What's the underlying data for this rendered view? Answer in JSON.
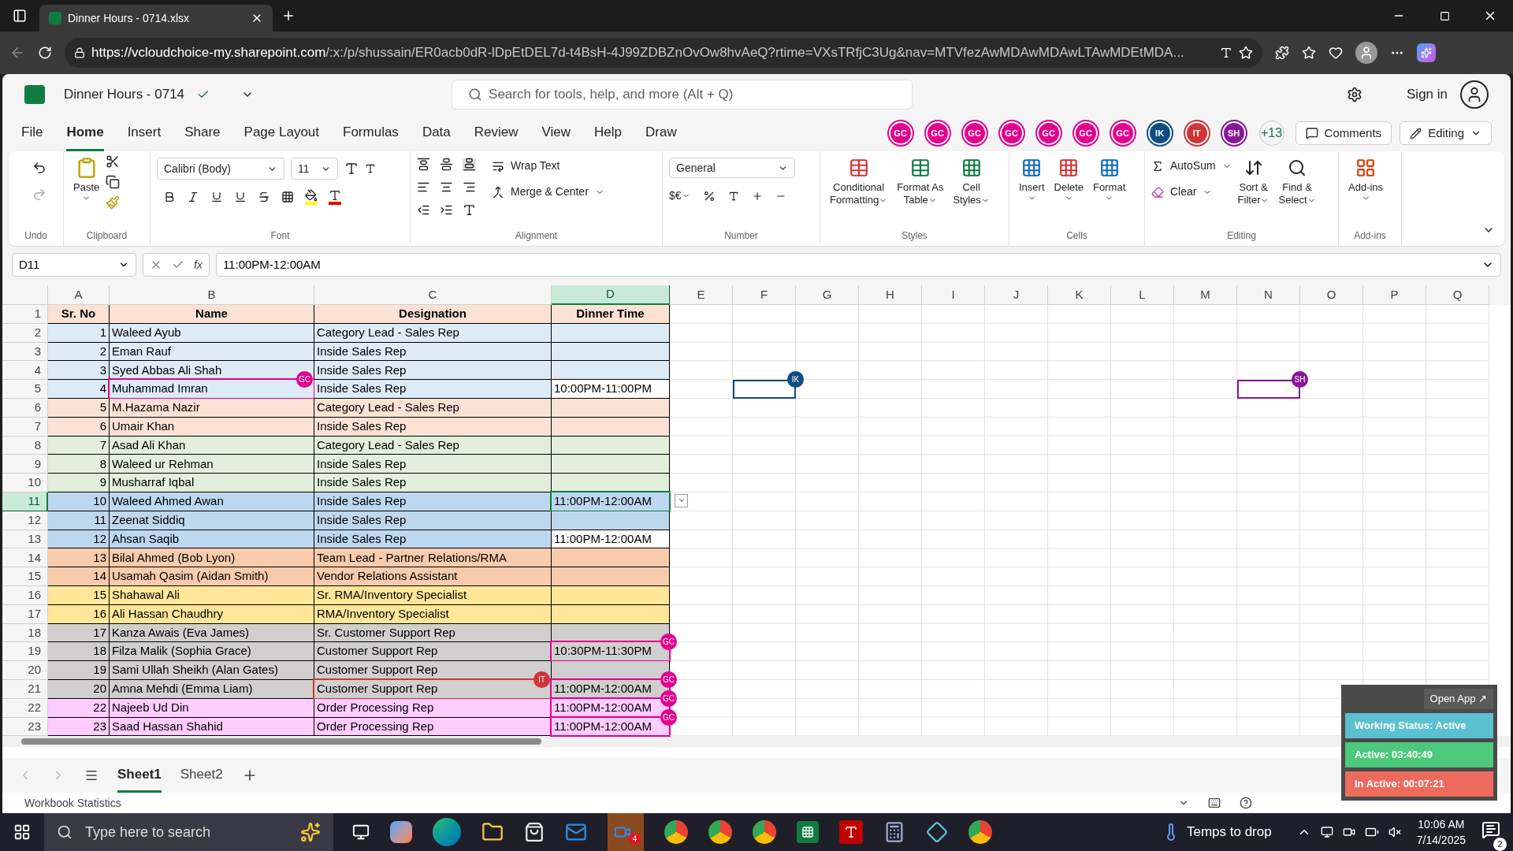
{
  "browser": {
    "tab_title": "Dinner Hours - 0714.xlsx",
    "url_host": "https://vcloudchoice-my.sharepoint.com",
    "url_rest": "/:x:/p/shussain/ER0acb0dR-lDpEtDEL7d-t4BsH-4J99ZDBZnOvOw8hvAeQ?rtime=VXsTRfjC3Ug&nav=MTVfezAwMDAwMDAwLTAwMDEtMDA..."
  },
  "app": {
    "file_name": "Dinner Hours - 0714",
    "search_placeholder": "Search for tools, help, and more (Alt + Q)",
    "sign_in": "Sign in"
  },
  "menu": [
    {
      "label": "File",
      "selected": false
    },
    {
      "label": "Home",
      "selected": true
    },
    {
      "label": "Insert",
      "selected": false
    },
    {
      "label": "Share",
      "selected": false
    },
    {
      "label": "Page Layout",
      "selected": false
    },
    {
      "label": "Formulas",
      "selected": false
    },
    {
      "label": "Data",
      "selected": false
    },
    {
      "label": "Review",
      "selected": false
    },
    {
      "label": "View",
      "selected": false
    },
    {
      "label": "Help",
      "selected": false
    },
    {
      "label": "Draw",
      "selected": false
    }
  ],
  "collaborators": [
    {
      "initials": "GC",
      "color": "#e3008c"
    },
    {
      "initials": "GC",
      "color": "#e3008c"
    },
    {
      "initials": "GC",
      "color": "#e3008c"
    },
    {
      "initials": "GC",
      "color": "#e3008c"
    },
    {
      "initials": "GC",
      "color": "#e3008c"
    },
    {
      "initials": "GC",
      "color": "#e3008c"
    },
    {
      "initials": "GC",
      "color": "#e3008c"
    },
    {
      "initials": "IK",
      "color": "#0f4c81"
    },
    {
      "initials": "IT",
      "color": "#d13438"
    },
    {
      "initials": "SH",
      "color": "#881798"
    }
  ],
  "more_collaborators": "+13",
  "comments": "Comments",
  "editing": "Editing",
  "ribbon": {
    "undo_group": "Undo",
    "paste": "Paste",
    "clipboard_group": "Clipboard",
    "font_name": "Calibri (Body)",
    "font_size": "11",
    "font_group": "Font",
    "wrap_text": "Wrap Text",
    "merge_center": "Merge & Center",
    "alignment_group": "Alignment",
    "number_format": "General",
    "currency": "$€",
    "number_group": "Number",
    "conditional_1": "Conditional",
    "conditional_2": "Formatting",
    "format_table_1": "Format As",
    "format_table_2": "Table",
    "cell_styles_1": "Cell",
    "cell_styles_2": "Styles",
    "styles_group": "Styles",
    "insert": "Insert",
    "delete": "Delete",
    "format": "Format",
    "cells_group": "Cells",
    "autosum": "AutoSum",
    "clear": "Clear",
    "sort_1": "Sort &",
    "sort_2": "Filter",
    "find_1": "Find &",
    "find_2": "Select",
    "editing_group": "Editing",
    "addins": "Add-ins",
    "addins_group": "Add-ins"
  },
  "formula_bar": {
    "name_box": "D11",
    "fx": "fx",
    "value": "11:00PM-12:00AM"
  },
  "sheet": {
    "columns": [
      {
        "label": "A",
        "selected": false
      },
      {
        "label": "B",
        "selected": false
      },
      {
        "label": "C",
        "selected": false
      },
      {
        "label": "D",
        "selected": true
      },
      {
        "label": "E",
        "selected": false
      },
      {
        "label": "F",
        "selected": false
      },
      {
        "label": "G",
        "selected": false
      },
      {
        "label": "H",
        "selected": false
      },
      {
        "label": "I",
        "selected": false
      },
      {
        "label": "J",
        "selected": false
      },
      {
        "label": "K",
        "selected": false
      },
      {
        "label": "L",
        "selected": false
      },
      {
        "label": "M",
        "selected": false
      },
      {
        "label": "N",
        "selected": false
      },
      {
        "label": "O",
        "selected": false
      },
      {
        "label": "P",
        "selected": false
      },
      {
        "label": "Q",
        "selected": false
      }
    ],
    "header_row": {
      "number": "1",
      "no": "Sr. No",
      "name": "Name",
      "designation": "Designation",
      "dinner_time": "Dinner Time",
      "color": "#fbe2d5"
    },
    "rows": [
      {
        "number": "2",
        "no": "1",
        "name": "Waleed Ayub",
        "designation": "Category Lead - Sales Rep",
        "color": "#ddebf7",
        "selected": false
      },
      {
        "number": "3",
        "no": "2",
        "name": "Eman Rauf",
        "designation": "Inside Sales Rep",
        "color": "#ddebf7",
        "selected": false
      },
      {
        "number": "4",
        "no": "3",
        "name": "Syed Abbas Ali Shah",
        "designation": "Inside Sales Rep",
        "color": "#ddebf7",
        "selected": false
      },
      {
        "number": "5",
        "no": "4",
        "name": "Muhammad Imran",
        "designation": "Inside Sales Rep",
        "dinner_time": "10:00PM-11:00PM",
        "color": "#ddebf7",
        "selected": false,
        "presence": {
          "B": {
            "initials": "GC",
            "color": "#e3008c"
          },
          "F": {
            "initials": "IK",
            "color": "#0f4c81"
          },
          "N": {
            "initials": "SH",
            "color": "#881798"
          }
        }
      },
      {
        "number": "6",
        "no": "5",
        "name": "M.Hazama Nazir",
        "designation": "Category Lead - Sales Rep",
        "color": "#fbe2d5",
        "selected": false
      },
      {
        "number": "7",
        "no": "6",
        "name": "Umair Khan",
        "designation": "Inside Sales Rep",
        "color": "#fbe2d5",
        "selected": false
      },
      {
        "number": "8",
        "no": "7",
        "name": "Asad Ali Khan",
        "designation": "Category Lead - Sales Rep",
        "color": "#e2efda",
        "selected": false
      },
      {
        "number": "9",
        "no": "8",
        "name": "Waleed ur Rehman",
        "designation": "Inside Sales Rep",
        "color": "#e2efda",
        "selected": false
      },
      {
        "number": "10",
        "no": "9",
        "name": "Musharraf Iqbal",
        "designation": "Inside Sales Rep",
        "color": "#e2efda",
        "selected": false
      },
      {
        "number": "11",
        "no": "10",
        "name": "Waleed Ahmed Awan",
        "designation": "Inside Sales Rep",
        "dinner_time": "11:00PM-12:00AM",
        "color": "#bdd7ee",
        "selected": true
      },
      {
        "number": "12",
        "no": "11",
        "name": "Zeenat Siddiq",
        "designation": "Inside Sales Rep",
        "color": "#bdd7ee",
        "selected": false
      },
      {
        "number": "13",
        "no": "12",
        "name": "Ahsan Saqib",
        "designation": "Inside Sales Rep",
        "dinner_time": "11:00PM-12:00AM",
        "color": "#bdd7ee",
        "selected": false
      },
      {
        "number": "14",
        "no": "13",
        "name": "Bilal Ahmed (Bob Lyon)",
        "designation": "Team Lead - Partner Relations/RMA",
        "color": "#f8cbad",
        "selected": false
      },
      {
        "number": "15",
        "no": "14",
        "name": "Usamah Qasim (Aidan Smith)",
        "designation": "Vendor Relations Assistant",
        "color": "#f8cbad",
        "selected": false
      },
      {
        "number": "16",
        "no": "15",
        "name": "Shahawal Ali",
        "designation": "Sr. RMA/Inventory Specialist",
        "color": "#ffe699",
        "selected": false
      },
      {
        "number": "17",
        "no": "16",
        "name": "Ali Hassan Chaudhry",
        "designation": "RMA/Inventory Specialist",
        "color": "#ffe699",
        "selected": false
      },
      {
        "number": "18",
        "no": "17",
        "name": "Kanza Awais (Eva James)",
        "designation": "Sr. Customer Support Rep",
        "color": "#d0cece",
        "selected": false
      },
      {
        "number": "19",
        "no": "18",
        "name": "Filza Malik (Sophia Grace)",
        "designation": "Customer Support Rep",
        "dinner_time": "10:30PM-11:30PM",
        "color": "#d0cece",
        "selected": false,
        "presence": {
          "D": {
            "initials": "GC",
            "color": "#e3008c"
          }
        }
      },
      {
        "number": "20",
        "no": "19",
        "name": "Sami Ullah Sheikh (Alan Gates)",
        "designation": "Customer Support Rep",
        "color": "#d0cece",
        "selected": false
      },
      {
        "number": "21",
        "no": "20",
        "name": "Amna Mehdi (Emma Liam)",
        "designation": "Customer Support Rep",
        "dinner_time": "11:00PM-12:00AM",
        "color": "#d0cece",
        "selected": false,
        "presence": {
          "C": {
            "initials": "IT",
            "color": "#d13438"
          },
          "D": {
            "initials": "GC",
            "color": "#e3008c"
          }
        }
      },
      {
        "number": "22",
        "no": "22",
        "name": "Najeeb Ud Din",
        "designation": "Order Processing Rep",
        "dinner_time": "11:00PM-12:00AM",
        "color": "#ffccff",
        "selected": false,
        "presence": {
          "D": {
            "initials": "GC",
            "color": "#e3008c"
          }
        }
      },
      {
        "number": "23",
        "no": "23",
        "name": "Saad Hassan Shahid",
        "designation": "Order Processing Rep",
        "dinner_time": "11:00PM-12:00AM",
        "color": "#ffccff",
        "selected": false,
        "presence": {
          "D": {
            "initials": "GC",
            "color": "#e3008c"
          }
        }
      }
    ]
  },
  "sheet_tabs": [
    {
      "label": "Sheet1",
      "selected": true
    },
    {
      "label": "Sheet2",
      "selected": false
    }
  ],
  "status_bar": {
    "text": "Workbook Statistics"
  },
  "tracker": {
    "open_app": "Open App ↗",
    "items": [
      {
        "label": "Working Status: Active",
        "color": "#5bc0cf"
      },
      {
        "label": "Active: 03:40:49",
        "color": "#4cc97a"
      },
      {
        "label": "In Active: 00:07:21",
        "color": "#ec6b5d"
      }
    ]
  },
  "taskbar": {
    "search_placeholder": "Type here to search",
    "zoom_badge": "4",
    "weather": "Temps to drop",
    "time": "10:06 AM",
    "date": "7/14/2025",
    "notifications": "2"
  }
}
